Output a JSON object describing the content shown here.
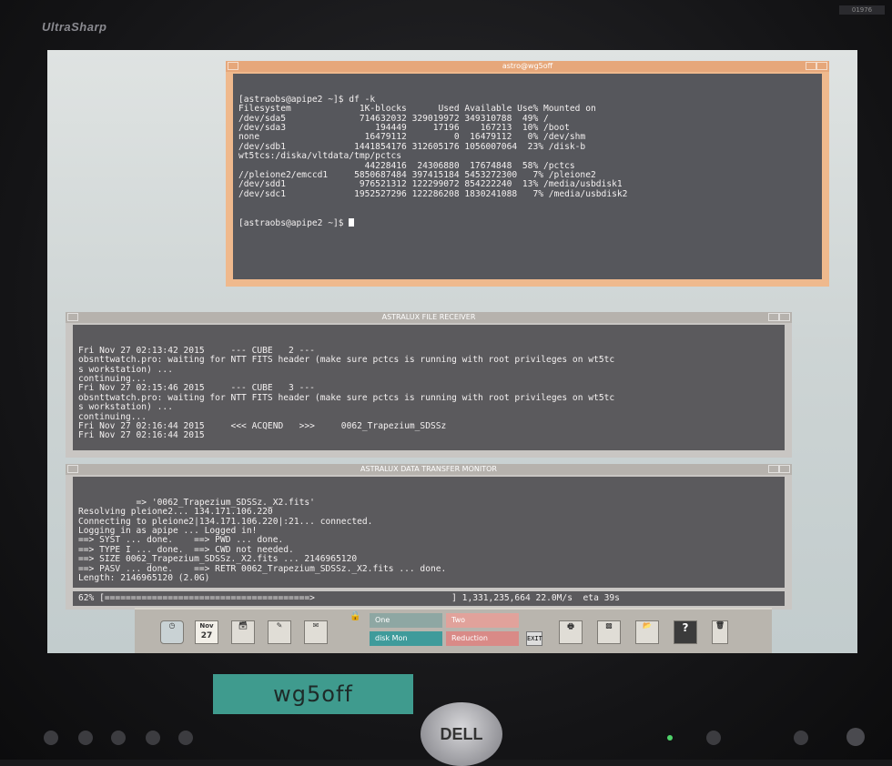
{
  "monitor": {
    "brand": "UltraSharp",
    "stand_label": "wg5off",
    "logo": "DELL",
    "corner_tag": "01976"
  },
  "window1": {
    "title": "astro@wg5off",
    "lines": [
      "[astraobs@apipe2 ~]$ df -k",
      "Filesystem             1K-blocks      Used Available Use% Mounted on",
      "/dev/sda5              714632032 329019972 349310788  49% /",
      "/dev/sda3                 194449     17196    167213  10% /boot",
      "none                    16479112         0  16479112   0% /dev/shm",
      "/dev/sdb1             1441854176 312605176 1056007064  23% /disk-b",
      "wt5tcs:/diska/vltdata/tmp/pctcs",
      "                        44228416  24306880  17674848  58% /pctcs",
      "//pleione2/emccd1     5850687484 397415184 5453272300   7% /pleione2",
      "/dev/sdd1              976521312 122299072 854222240  13% /media/usbdisk1",
      "/dev/sdc1             1952527296 122286208 1830241088   7% /media/usbdisk2"
    ],
    "prompt": "[astraobs@apipe2 ~]$ "
  },
  "window2": {
    "title": "ASTRALUX FILE RECEIVER",
    "lines": [
      "Fri Nov 27 02:13:42 2015     --- CUBE   2 ---",
      "obsnttwatch.pro: waiting for NTT FITS header (make sure pctcs is running with root privileges on wt5tc",
      "s workstation) ...",
      "continuing...",
      "Fri Nov 27 02:15:46 2015     --- CUBE   3 ---",
      "obsnttwatch.pro: waiting for NTT FITS header (make sure pctcs is running with root privileges on wt5tc",
      "s workstation) ...",
      "continuing...",
      "Fri Nov 27 02:16:44 2015     <<< ACQEND   >>>     0062_Trapezium_SDSSz",
      "Fri Nov 27 02:16:44 2015"
    ]
  },
  "window3": {
    "title": "ASTRALUX DATA TRANSFER MONITOR",
    "lines": [
      "           => '0062_Trapezium_SDSSz._X2.fits'",
      "Resolving pleione2... 134.171.106.220",
      "Connecting to pleione2|134.171.106.220|:21... connected.",
      "Logging in as apipe ... Logged in!",
      "==> SYST ... done.    ==> PWD ... done.",
      "==> TYPE I ... done.  ==> CWD not needed.",
      "==> SIZE 0062_Trapezium_SDSSz._X2.fits ... 2146965120",
      "==> PASV ... done.    ==> RETR 0062_Trapezium_SDSSz._X2.fits ... done.",
      "Length: 2146965120 (2.0G)"
    ],
    "progress_percent": "62%",
    "progress_bar": "[=======================================>",
    "progress_stats": "] 1,331,235,664 22.0M/s  eta 39s",
    "progress_value": 0.62
  },
  "dock": {
    "calendar_month": "Nov",
    "calendar_day": "27",
    "workspaces": [
      {
        "label": "One",
        "color": "#8ea7a3"
      },
      {
        "label": "Two",
        "color": "#e1a29b"
      },
      {
        "label": "disk Mon",
        "color": "#3f9b9b"
      },
      {
        "label": "Reduction",
        "color": "#d98a87"
      }
    ],
    "help_label": "?"
  }
}
